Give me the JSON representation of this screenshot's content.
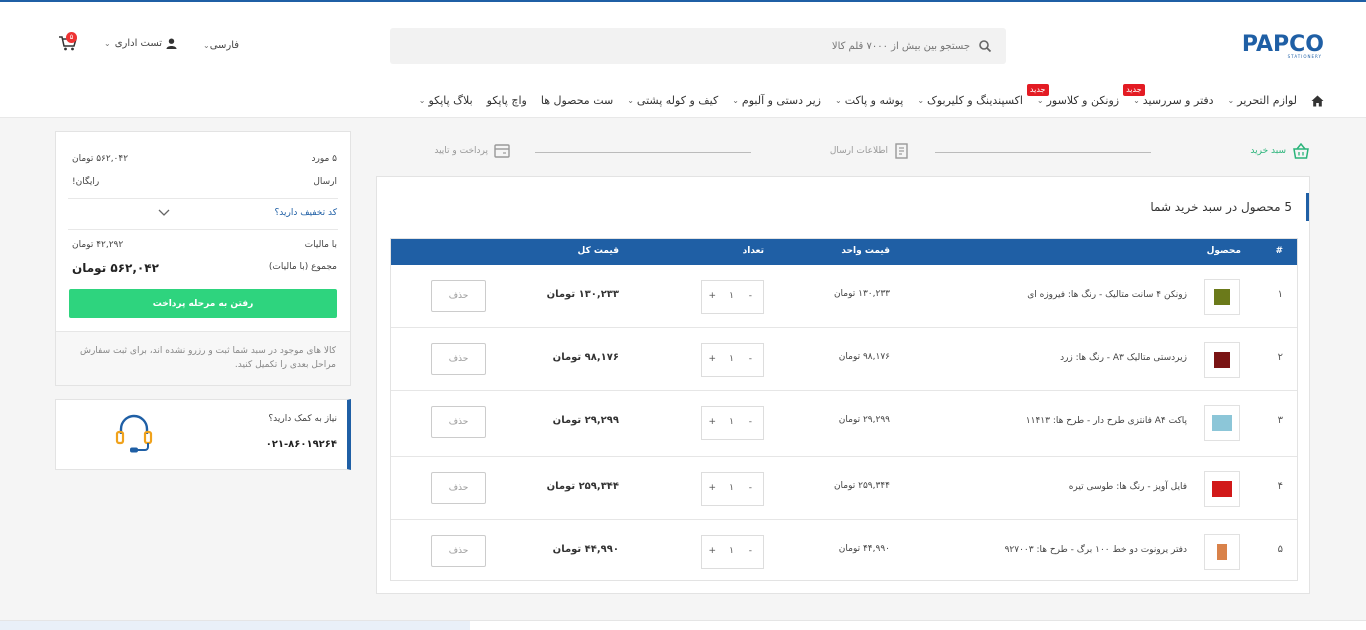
{
  "brand": {
    "name": "PAPCO",
    "tagline": "STATIONERY",
    "color": "#1f5fa5"
  },
  "header": {
    "search_placeholder": "جستجو بین بیش از ۷۰۰۰ قلم کالا",
    "language": "فارسی",
    "user": "تست اداری",
    "cart_count": "۵"
  },
  "menu": {
    "new_label": "جدید",
    "items": [
      {
        "label": "لوازم التحریر"
      },
      {
        "label": "دفتر و سررسید"
      },
      {
        "label": "زونکن و کلاسور"
      },
      {
        "label": "اکسپندینگ و کلیربوک"
      },
      {
        "label": "پوشه و پاکت"
      },
      {
        "label": "زیر دستی و آلبوم"
      },
      {
        "label": "کیف و کوله پشتی"
      },
      {
        "label": "ست محصول ها"
      },
      {
        "label": "واچ پاپکو"
      },
      {
        "label": "بلاگ پاپکو"
      }
    ]
  },
  "steps": {
    "cart": "سبد خرید",
    "shipping": "اطلاعات ارسال",
    "payment": "پرداخت و تایید"
  },
  "cart": {
    "title": "5 محصول در سبد خرید شما",
    "columns": {
      "index": "#",
      "product": "محصول",
      "unit_price": "قیمت واحد",
      "qty": "تعداد",
      "total": "قیمت کل"
    },
    "delete_label": "حذف",
    "rows": [
      {
        "index": "۱",
        "name": "زونکن ۴ سانت متالیک - رنگ ها: فیروزه ای",
        "unit": "۱۳۰,۲۳۳ تومان",
        "qty": "۱",
        "total": "۱۳۰,۲۳۳ تومان",
        "thumb_color": "#6b7a1a"
      },
      {
        "index": "۲",
        "name": "زیردستی متالیک A۳ - رنگ ها: زرد",
        "unit": "۹۸,۱۷۶ تومان",
        "qty": "۱",
        "total": "۹۸,۱۷۶ تومان",
        "thumb_color": "#7a1414"
      },
      {
        "index": "۳",
        "name": "پاکت A۴ فانتزی طرح دار - طرح ها: ۱۱۴۱۳",
        "unit": "۲۹,۲۹۹ تومان",
        "qty": "۱",
        "total": "۲۹,۲۹۹ تومان",
        "thumb_color": "#8cc6d8"
      },
      {
        "index": "۴",
        "name": "فایل آویز - رنگ ها: طوسی تیره",
        "unit": "۲۵۹,۳۴۴ تومان",
        "qty": "۱",
        "total": "۲۵۹,۳۴۴ تومان",
        "thumb_color": "#d11919"
      },
      {
        "index": "۵",
        "name": "دفتر یرونوت دو خط ۱۰۰ برگ - طرح ها: ۹۲۷۰۰۳",
        "unit": "۴۴,۹۹۰ تومان",
        "qty": "۱",
        "total": "۴۴,۹۹۰ تومان",
        "thumb_color": "#d9824a"
      }
    ]
  },
  "summary": {
    "items_label": "۵ مورد",
    "items_value": "۵۶۲,۰۴۲ تومان",
    "shipping_label": "ارسال",
    "shipping_value": "رایگان!",
    "discount_label": "کد تخفیف دارید؟",
    "tax_label": "با مالیات",
    "tax_value": "۴۲,۲۹۲ تومان",
    "total_label": "مجموع (با مالیات)",
    "total_value": "۵۶۲,۰۴۲ تومان",
    "pay_button": "رفتن به مرحله پرداخت",
    "note": "کالا های موجود در سبد شما ثبت و رزرو نشده اند، برای ثبت سفارش مراحل بعدی را تکمیل کنید."
  },
  "help": {
    "question": "نیاز به کمک دارید؟",
    "phone": "۰۲۱-۸۶۰۱۹۲۶۴"
  },
  "colors": {
    "accent": "#1f5fa5",
    "green": "#2ed47e",
    "red": "#e31b23"
  }
}
